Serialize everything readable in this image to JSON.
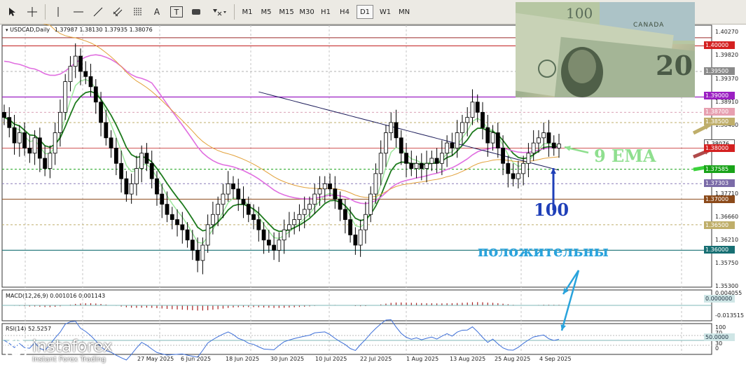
{
  "toolbar": {
    "text_tool": "A",
    "label_tool": "T",
    "timeframes": [
      "M1",
      "M5",
      "M15",
      "M30",
      "H1",
      "H4",
      "D1",
      "W1",
      "MN"
    ],
    "active_timeframe": "D1"
  },
  "chart_header": {
    "symbol": "USDCAD,Daily",
    "ohlc": "1.37987 1.38130 1.37935 1.38076"
  },
  "price_axis": [
    "1.40270",
    "1.39820",
    "1.39370",
    "1.38910",
    "1.38460",
    "1.37710",
    "1.36660",
    "1.36210",
    "1.35750",
    "1.35300"
  ],
  "price_labels": [
    {
      "text": "1.40000",
      "bg": "#d42020",
      "fg": "#ffffff"
    },
    {
      "text": "1.39500",
      "bg": "#8a8a8a",
      "fg": "#ffffff"
    },
    {
      "text": "1.39000",
      "bg": "#9b1fc2",
      "fg": "#ffffff"
    },
    {
      "text": "1.38700",
      "bg": "#e7a0b0",
      "fg": "#ffffff"
    },
    {
      "text": "1.38500",
      "bg": "#bfae6a",
      "fg": "#ffffff"
    },
    {
      "text": "1.38076",
      "bg": "#ffffff",
      "fg": "#000000"
    },
    {
      "text": "1.38000",
      "bg": "#d42020",
      "fg": "#ffffff"
    },
    {
      "text": "1.37585",
      "bg": "#19a319",
      "fg": "#ffffff"
    },
    {
      "text": "1.37303",
      "bg": "#7b6ba8",
      "fg": "#ffffff"
    },
    {
      "text": "1.37000",
      "bg": "#8b4a1a",
      "fg": "#ffffff"
    },
    {
      "text": "1.36500",
      "bg": "#bfae6a",
      "fg": "#ffffff"
    },
    {
      "text": "1.36000",
      "bg": "#176f73",
      "fg": "#ffffff"
    }
  ],
  "time_axis": [
    "27 May 2025",
    "6 Jun 2025",
    "18 Jun 2025",
    "30 Jun 2025",
    "10 Jul 2025",
    "22 Jul 2025",
    "1 Aug 2025",
    "13 Aug 2025",
    "25 Aug 2025",
    "4 Sep 2025"
  ],
  "macd": {
    "header": "MACD(12,26,9) 0.001016 0.001143",
    "axis": [
      "0.004055",
      "-0.013515"
    ],
    "label": "0.000000"
  },
  "rsi": {
    "header": "RSI(14) 52.5257",
    "axis": [
      "100",
      "70",
      "30",
      "0"
    ],
    "label": "50.0000"
  },
  "annotations": {
    "ema": "9 EMA",
    "ma100": "100",
    "positive": "положительны"
  },
  "photo": {
    "country": "CANADA",
    "denom_top": "100",
    "denom_main": "20"
  },
  "logo": {
    "name": "instaforex",
    "tagline": "Instant Forex Trading"
  },
  "colors": {
    "ema_fast": "#1d7a1d",
    "ema_light": "#9ee79e",
    "ma_pink": "#e06ee0",
    "ma_navy": "#1c1c5a",
    "ma_orange": "#e2a13a",
    "ema_annotation": "#8fdf8f",
    "ma100_annotation": "#1f3fb8",
    "positive_annotation": "#29a3dc"
  },
  "chart_data": {
    "type": "candlestick",
    "title": "USDCAD,Daily",
    "x_labels": [
      "27 May 2025",
      "6 Jun 2025",
      "18 Jun 2025",
      "30 Jun 2025",
      "10 Jul 2025",
      "22 Jul 2025",
      "1 Aug 2025",
      "13 Aug 2025",
      "25 Aug 2025",
      "4 Sep 2025"
    ],
    "ylim": [
      1.3525,
      1.4035
    ],
    "last_close": 1.38076,
    "horizontal_levels": [
      1.4,
      1.395,
      1.39,
      1.387,
      1.385,
      1.38,
      1.37585,
      1.37303,
      1.37,
      1.365,
      1.36
    ]
  }
}
